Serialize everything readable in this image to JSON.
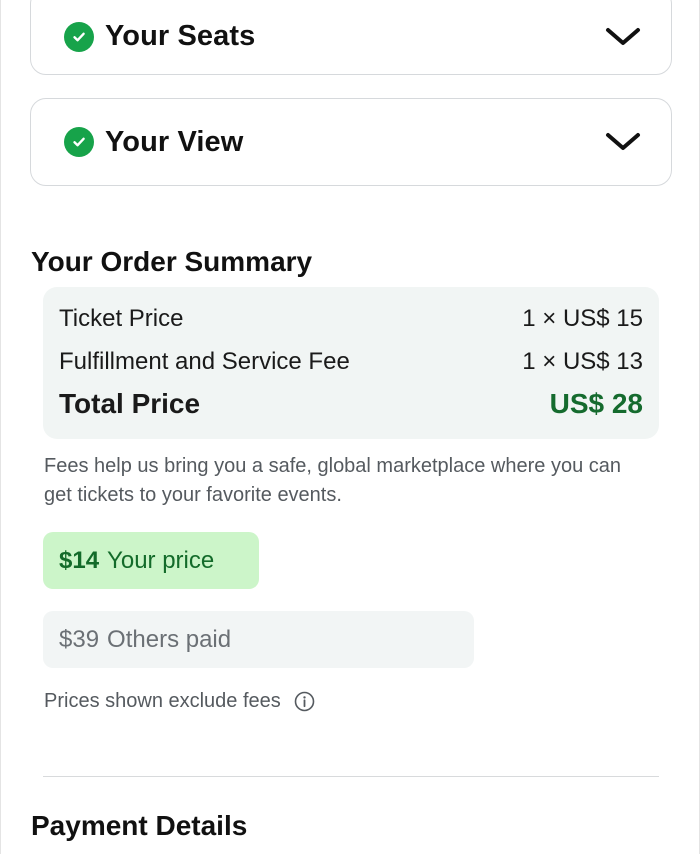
{
  "accordions": {
    "seats": {
      "title": "Your Seats"
    },
    "view": {
      "title": "Your View"
    }
  },
  "order_summary": {
    "title": "Your Order Summary",
    "rows": [
      {
        "label": "Ticket Price",
        "value": "1 × US$ 15"
      },
      {
        "label": "Fulfillment and Service Fee",
        "value": "1 × US$ 13"
      }
    ],
    "total": {
      "label": "Total Price",
      "value": "US$ 28"
    },
    "fees_note": "Fees help us bring you a safe, global marketplace where you can get tickets to your favorite events."
  },
  "price_compare": {
    "your_price": {
      "amount": "$14",
      "label": "Your price"
    },
    "others_paid": {
      "amount": "$39",
      "label": "Others paid"
    },
    "note": "Prices shown exclude fees"
  },
  "payment": {
    "title": "Payment Details"
  },
  "colors": {
    "check_green": "#17a34a",
    "total_green": "#156b2e",
    "your_price_bg": "#ccf5c9",
    "summary_bg": "#f1f5f4"
  }
}
